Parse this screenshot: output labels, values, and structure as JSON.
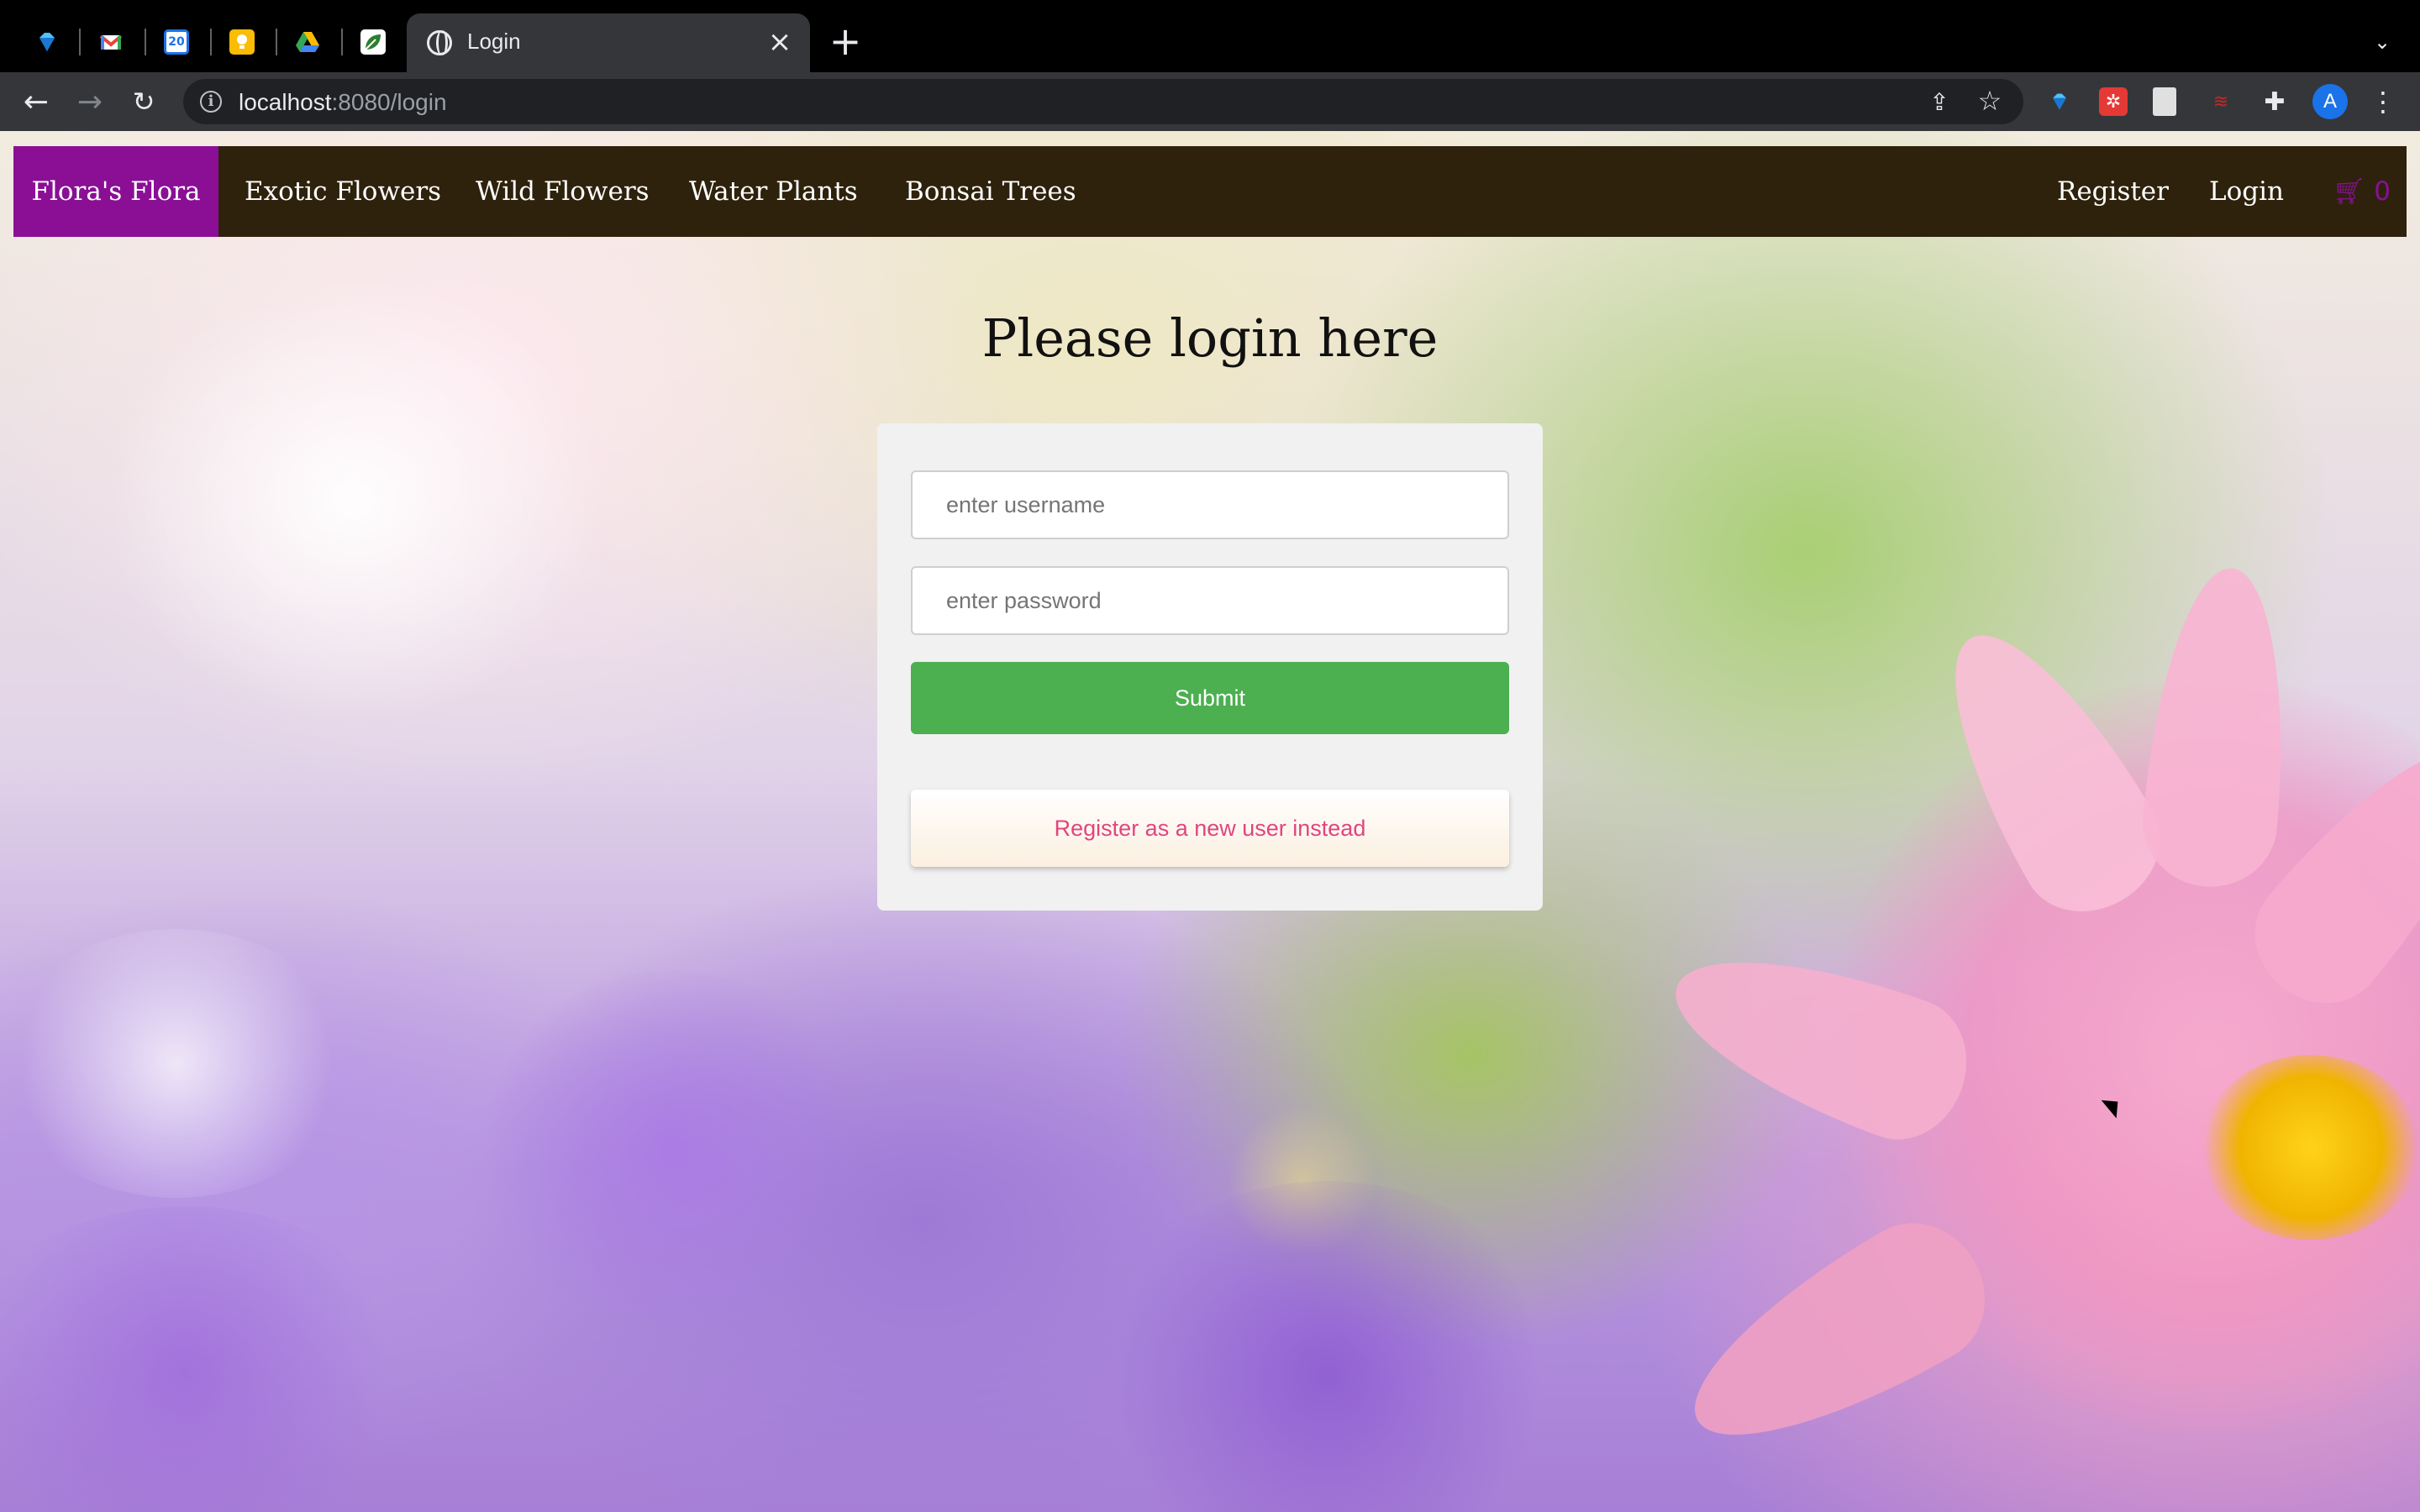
{
  "browser": {
    "pinned_tabs": [
      {
        "icon": "diamond-icon",
        "color": "#4fc3f7"
      },
      {
        "icon": "gmail-icon",
        "color": "#ea4335"
      },
      {
        "icon": "calendar-icon",
        "color": "#1a73e8",
        "label": "20"
      },
      {
        "icon": "keep-icon",
        "color": "#fbbc04"
      },
      {
        "icon": "drive-icon",
        "color": "#34a853"
      },
      {
        "icon": "leaf-icon",
        "color": "#2e7d32"
      }
    ],
    "active_tab": {
      "title": "Login",
      "icon": "globe-icon"
    },
    "url": {
      "host": "localhost",
      "rest": ":8080/login"
    },
    "profile_initial": "A"
  },
  "nav": {
    "brand": "Flora's Flora",
    "links": [
      "Exotic Flowers",
      "Wild Flowers",
      "Water Plants",
      "Bonsai Trees"
    ],
    "register": "Register",
    "login": "Login",
    "cart_count": "0",
    "brand_color": "#8a0f95",
    "bar_color": "#2e220c"
  },
  "login": {
    "heading": "Please login here",
    "username_placeholder": "enter username",
    "password_placeholder": "enter password",
    "submit_label": "Submit",
    "register_label": "Register as a new user instead",
    "submit_color": "#4caf50"
  }
}
